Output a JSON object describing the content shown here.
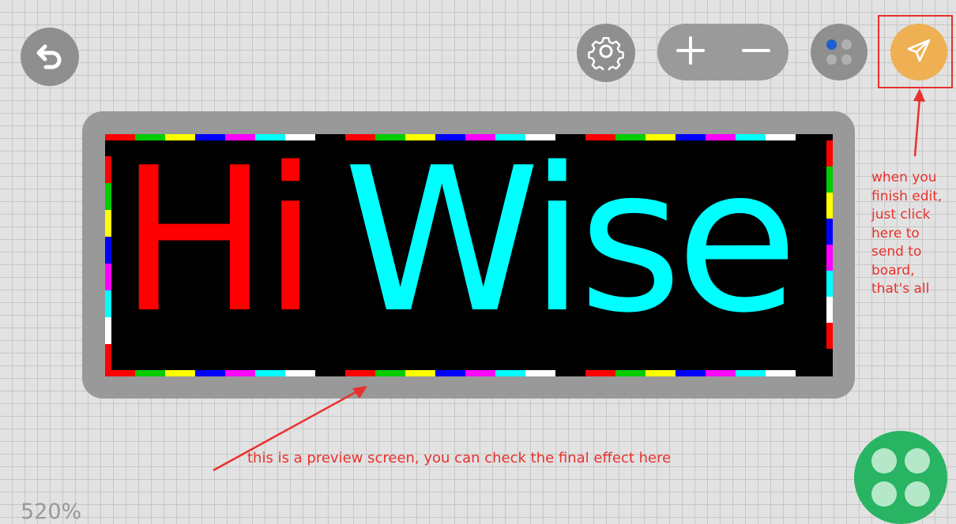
{
  "toolbar": {
    "back_icon": "undo-arrow-icon",
    "settings_icon": "gear-icon",
    "zoom_in_icon": "plus-icon",
    "zoom_out_icon": "minus-icon",
    "color_icon": "color-dots-icon",
    "send_icon": "paper-plane-icon"
  },
  "preview": {
    "word1": "Hi",
    "word2": "Wise",
    "word1_color": "#ff0000",
    "word2_color": "#00ffff",
    "border_colors": [
      "#ff0000",
      "#00cc00",
      "#ffff00",
      "#0000ff",
      "#ff00ff",
      "#00ffff",
      "#ffffff"
    ]
  },
  "annotations": {
    "send_note_lines": [
      "when you",
      "finish edit,",
      "just click",
      "here to",
      "send to",
      "board,",
      "that's all"
    ],
    "preview_note": "this is a preview screen, you can check the final effect here"
  },
  "zoom_level": "520%",
  "colors": {
    "annotation": "#e8312d",
    "send_button": "#eeb053",
    "apps_button": "#28b463",
    "toolbar_button": "#8f8f8f"
  }
}
